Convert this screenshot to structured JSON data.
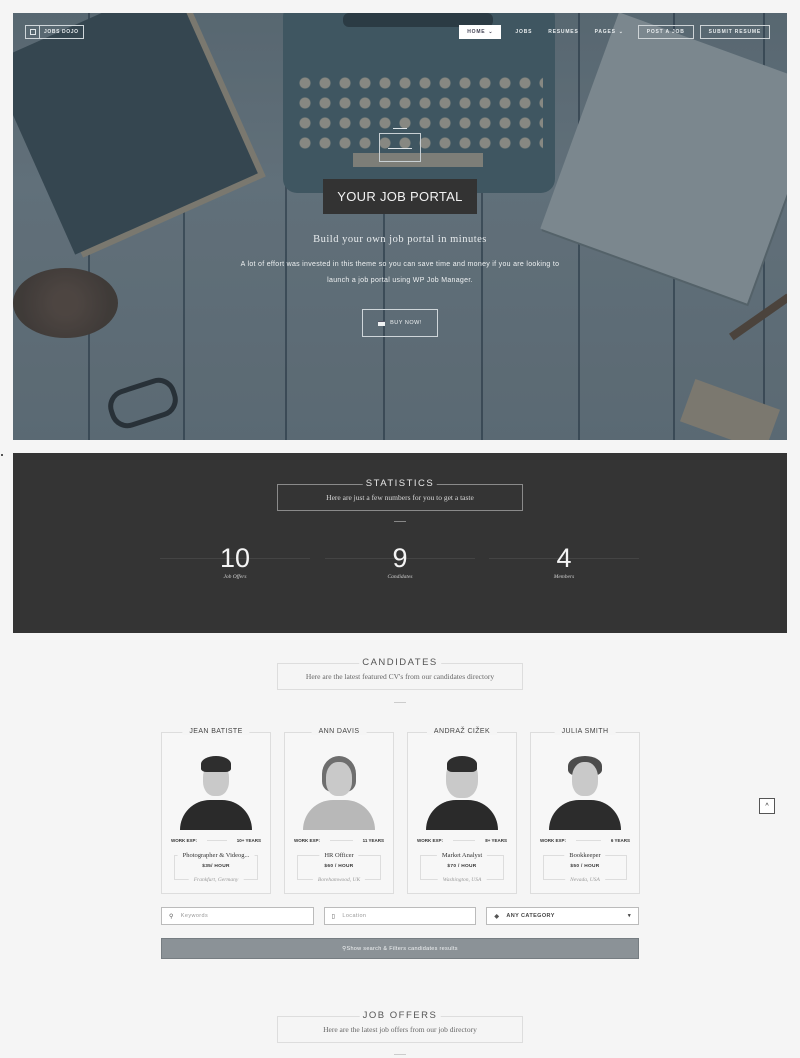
{
  "header": {
    "logo_text": "JOBS DOJO",
    "logo_icon": "briefcase-icon",
    "nav": [
      {
        "label": "HOME",
        "active": true,
        "dropdown": true
      },
      {
        "label": "JOBS"
      },
      {
        "label": "RESUMES"
      },
      {
        "label": "PAGES",
        "dropdown": true
      },
      {
        "label": "POST A JOB",
        "outlined": true
      },
      {
        "label": "SUBMIT RESUME",
        "outlined": true
      }
    ]
  },
  "hero": {
    "title": "YOUR JOB PORTAL",
    "subtitle": "Build your own job portal in minutes",
    "text_line1": "A lot of effort was invested in this theme so you can save time and money if you are looking to",
    "text_line2": "launch a job portal using WP Job Manager.",
    "button_label": "BUY NOW!",
    "button_icon": "credit-card-icon"
  },
  "statistics": {
    "title": "STATISTICS",
    "subtitle": "Here are just a few numbers for you to get a taste",
    "items": [
      {
        "value": "10",
        "label": "Job Offers"
      },
      {
        "value": "9",
        "label": "Candidates"
      },
      {
        "value": "4",
        "label": "Members"
      }
    ]
  },
  "candidates": {
    "title": "CANDIDATES",
    "subtitle": "Here are the latest featured CV's from our candidates directory",
    "work_exp_label": "WORK EXP:",
    "items": [
      {
        "name": "JEAN BATISTE",
        "exp": "10+ YEARS",
        "title": "Photographer & Videog...",
        "rate": "$35/ HOUR",
        "location": "Frankfurt, Germany"
      },
      {
        "name": "ANN DAVIS",
        "exp": "11 YEARS",
        "title": "HR Officer",
        "rate": "$60 / HOUR",
        "location": "Borehamwood, UK"
      },
      {
        "name": "ANDRAŽ CIŽEK",
        "exp": "8+ YEARS",
        "title": "Market Analyst",
        "rate": "$70 / HOUR",
        "location": "Washington, USA"
      },
      {
        "name": "JULIA SMITH",
        "exp": "6 YEARS",
        "title": "Bookkeeper",
        "rate": "$50 / HOUR",
        "location": "Nevada, USA"
      }
    ],
    "search": {
      "keywords_placeholder": "Keywords",
      "location_placeholder": "Location",
      "category_value": "ANY CATEGORY",
      "button_label": "Show search & Filters candidates results"
    }
  },
  "job_offers": {
    "title": "JOB OFFERS",
    "subtitle": "Here are the latest job offers from our job directory"
  },
  "back_to_top": "^"
}
